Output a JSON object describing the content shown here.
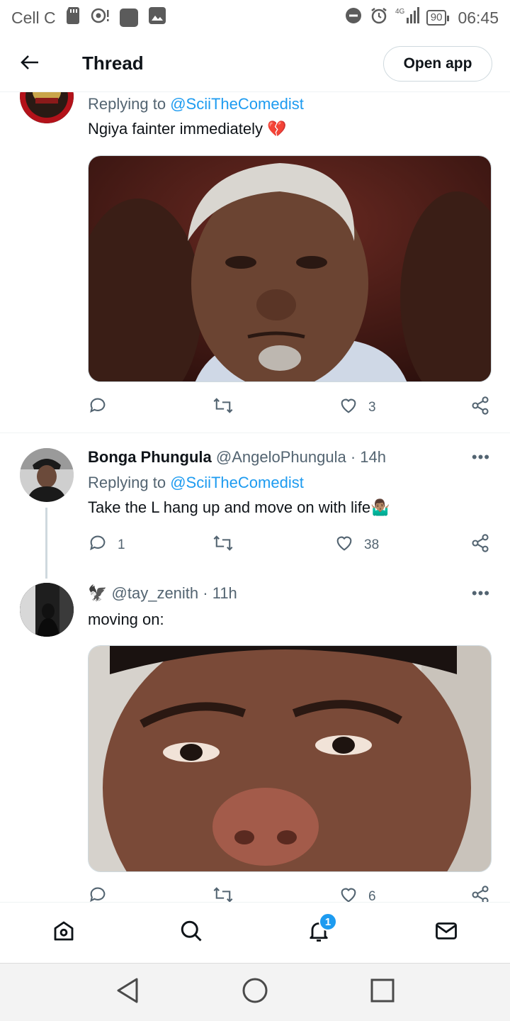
{
  "status_bar": {
    "carrier": "Cell C",
    "battery": "90",
    "network": "4G",
    "time": "06:45"
  },
  "header": {
    "title": "Thread",
    "open_app_label": "Open app"
  },
  "tweets": [
    {
      "replying_label": "Replying to",
      "replying_to": "@SciiTheComedist",
      "text": "Ngiya fainter immediately",
      "emoji": "💔",
      "likes": "3"
    },
    {
      "name": "Bonga Phungula",
      "handle": "@AngeloPhungula",
      "time": "· 14h",
      "replying_label": "Replying to",
      "replying_to": "@SciiTheComedist",
      "text": "Take the L hang up and move on with life",
      "emoji": "🤷🏽‍♂️",
      "replies": "1",
      "likes": "38"
    },
    {
      "name_icon": "🦅",
      "handle": "@tay_zenith",
      "time": "· 11h",
      "text": "moving on:",
      "likes": "6"
    }
  ],
  "bottom_nav": {
    "notification_count": "1"
  },
  "colors": {
    "accent": "#1d9bf0",
    "secondary_text": "#536471",
    "primary_text": "#0f1419"
  }
}
